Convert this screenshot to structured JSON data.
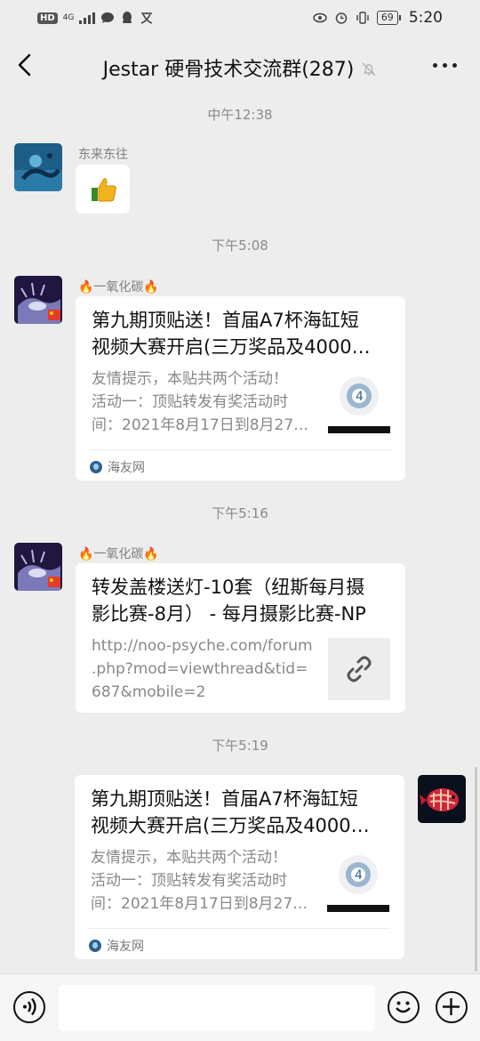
{
  "status_bar": {
    "hd": "HD",
    "network": "4G",
    "battery": "69",
    "time": "5:20"
  },
  "chat": {
    "title": "Jestar 硬骨技术交流群(287)"
  },
  "messages": [
    {
      "timestamp": "中午12:38",
      "sender": "东来东往",
      "content_type": "emoji",
      "emoji": "thumbs-up"
    },
    {
      "timestamp": "下午5:08",
      "sender": "🔥一氧化碳🔥",
      "card": {
        "title_line1": "第九期顶贴送！首届A7杯海缸短",
        "title_line2": "视频大赛开启(三万奖品及4000…",
        "desc_line1": "友情提示，本贴共两个活动！",
        "desc_line2": "活动一：顶贴转发有奖活动时",
        "desc_line3": "间：2021年8月17日到8月27…",
        "source": "海友网"
      }
    },
    {
      "timestamp": "下午5:16",
      "sender": "🔥一氧化碳🔥",
      "card": {
        "title_line1": "转发盖楼送灯-10套（纽斯每月摄",
        "title_line2": "影比赛-8月） - 每月摄影比赛-NP",
        "desc_line1": "http://noo-psyche.com/forum",
        "desc_line2": ".php?mod=viewthread&tid=",
        "desc_line3": "687&mobile=2"
      }
    },
    {
      "timestamp": "下午5:19",
      "sender": "",
      "card": {
        "title_line1": "第九期顶贴送！首届A7杯海缸短",
        "title_line2": "视频大赛开启(三万奖品及4000…",
        "desc_line1": "友情提示，本贴共两个活动！",
        "desc_line2": "活动一：顶贴转发有奖活动时",
        "desc_line3": "间：2021年8月17日到8月27…",
        "source": "海友网"
      }
    }
  ],
  "icons": {
    "back": "chevron-left-icon",
    "mute": "bell-off-icon",
    "more": "more-dots-icon",
    "voice": "voice-icon",
    "emoji": "emoji-icon",
    "plus": "plus-icon",
    "link": "link-icon"
  }
}
